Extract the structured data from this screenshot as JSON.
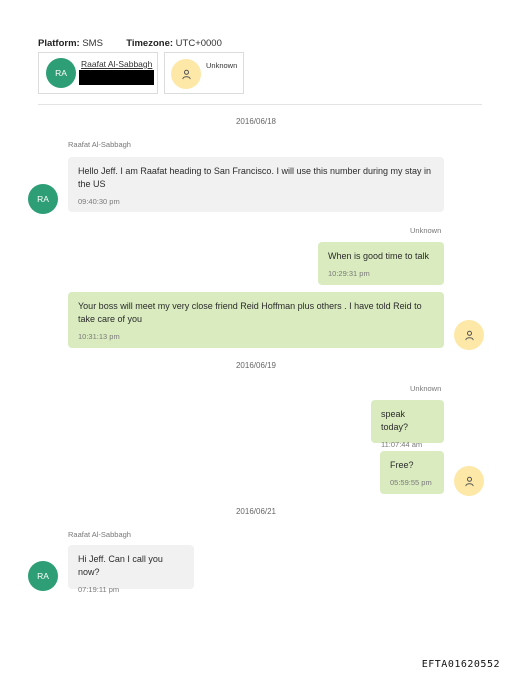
{
  "header": {
    "platform_label": "Platform:",
    "platform_value": "SMS",
    "timezone_label": "Timezone:",
    "timezone_value": "UTC+0000"
  },
  "participants": [
    {
      "initials": "RA",
      "name": "Raafat Al-Sabbagh",
      "avatar_color": "#2e9e76"
    },
    {
      "name": "Unknown",
      "avatar_color": "#fde8a8",
      "icon": "person-icon"
    }
  ],
  "conversation": {
    "dates": [
      "2016/06/18",
      "2016/06/19",
      "2016/06/21"
    ],
    "messages": [
      {
        "sender": "Raafat Al-Sabbagh",
        "initials": "RA",
        "text": "Hello Jeff. I am Raafat heading to San Francisco. I will use this number during my stay in the US",
        "time": "09:40:30 pm",
        "direction": "incoming"
      },
      {
        "sender": "Unknown",
        "text": "When is good time to talk",
        "time": "10:29:31 pm",
        "direction": "outgoing"
      },
      {
        "text": "Your boss will meet my very close friend Reid Hoffman plus others . I have told Reid to take care of you",
        "time": "10:31:13 pm",
        "direction": "outgoing"
      },
      {
        "sender": "Unknown",
        "text": "speak today?",
        "time": "11:07:44 am",
        "direction": "outgoing"
      },
      {
        "text": "Free?",
        "time": "05:59:55 pm",
        "direction": "outgoing"
      },
      {
        "sender": "Raafat Al-Sabbagh",
        "initials": "RA",
        "text": "Hi Jeff. Can I call you now?",
        "time": "07:19:11 pm",
        "direction": "incoming"
      }
    ]
  },
  "colors": {
    "incoming_bubble": "#f1f1f1",
    "outgoing_bubble": "#d9ebbf",
    "ra_avatar": "#2e9e76",
    "unknown_avatar": "#fde8a8"
  },
  "footer": {
    "doc_id": "EFTA01620552"
  }
}
